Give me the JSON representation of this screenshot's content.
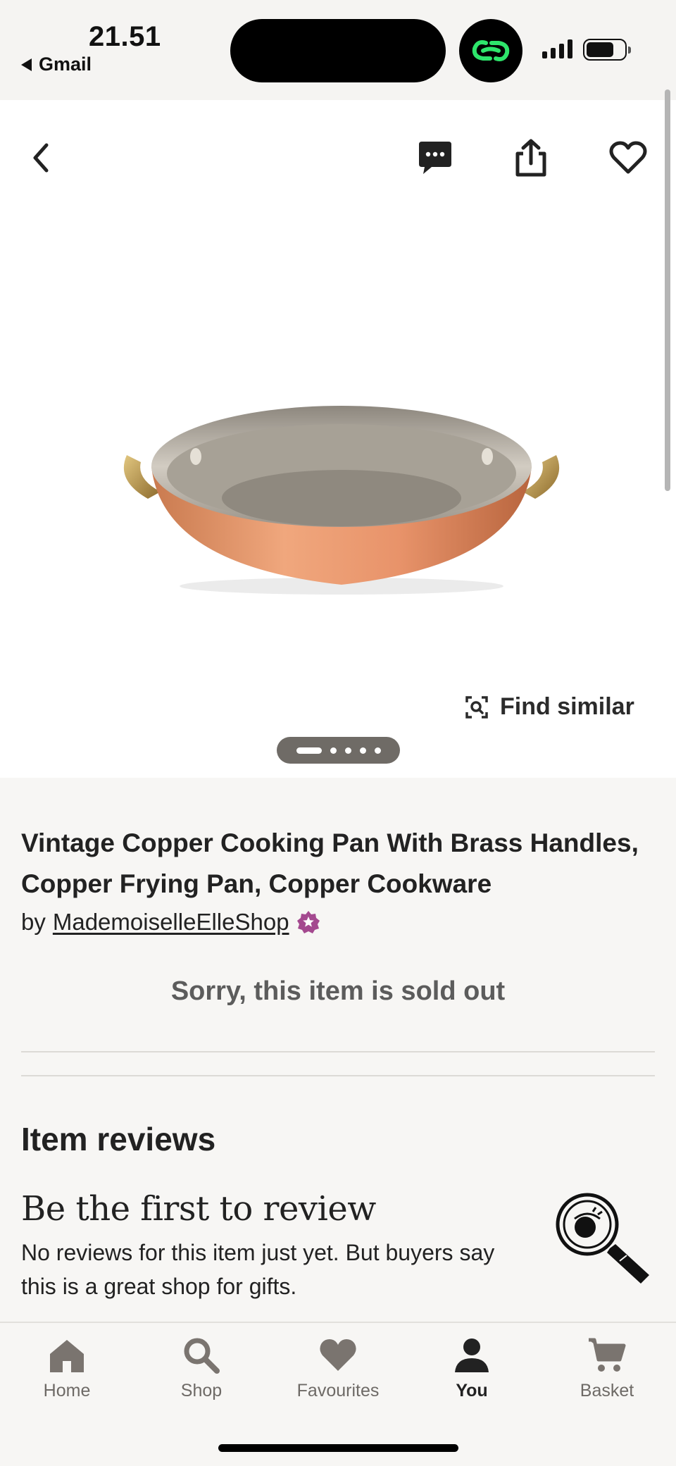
{
  "status_bar": {
    "time": "21.51",
    "back_app": "Gmail"
  },
  "listing": {
    "title": "Vintage Copper Cooking Pan With Brass Handles, Copper Frying Pan, Copper Cookware",
    "by_prefix": "by",
    "shop_name": "MademoiselleElleShop",
    "sold_out_text": "Sorry, this item is sold out",
    "find_similar_label": "Find similar",
    "image_count": 5,
    "current_image": 1
  },
  "reviews": {
    "heading": "Item reviews",
    "first_review_title": "Be the first to review",
    "subtitle": "No reviews for this item just yet. But buyers say this is a great shop for gifts."
  },
  "tab_bar": {
    "items": [
      {
        "label": "Home",
        "icon": "home-icon"
      },
      {
        "label": "Shop",
        "icon": "search-icon"
      },
      {
        "label": "Favourites",
        "icon": "heart-icon"
      },
      {
        "label": "You",
        "icon": "person-icon"
      },
      {
        "label": "Basket",
        "icon": "cart-icon"
      }
    ],
    "active": "You"
  },
  "colors": {
    "accent_green": "#2ee56b",
    "star_seller_purple": "#a4498f",
    "background": "#f7f6f4"
  }
}
